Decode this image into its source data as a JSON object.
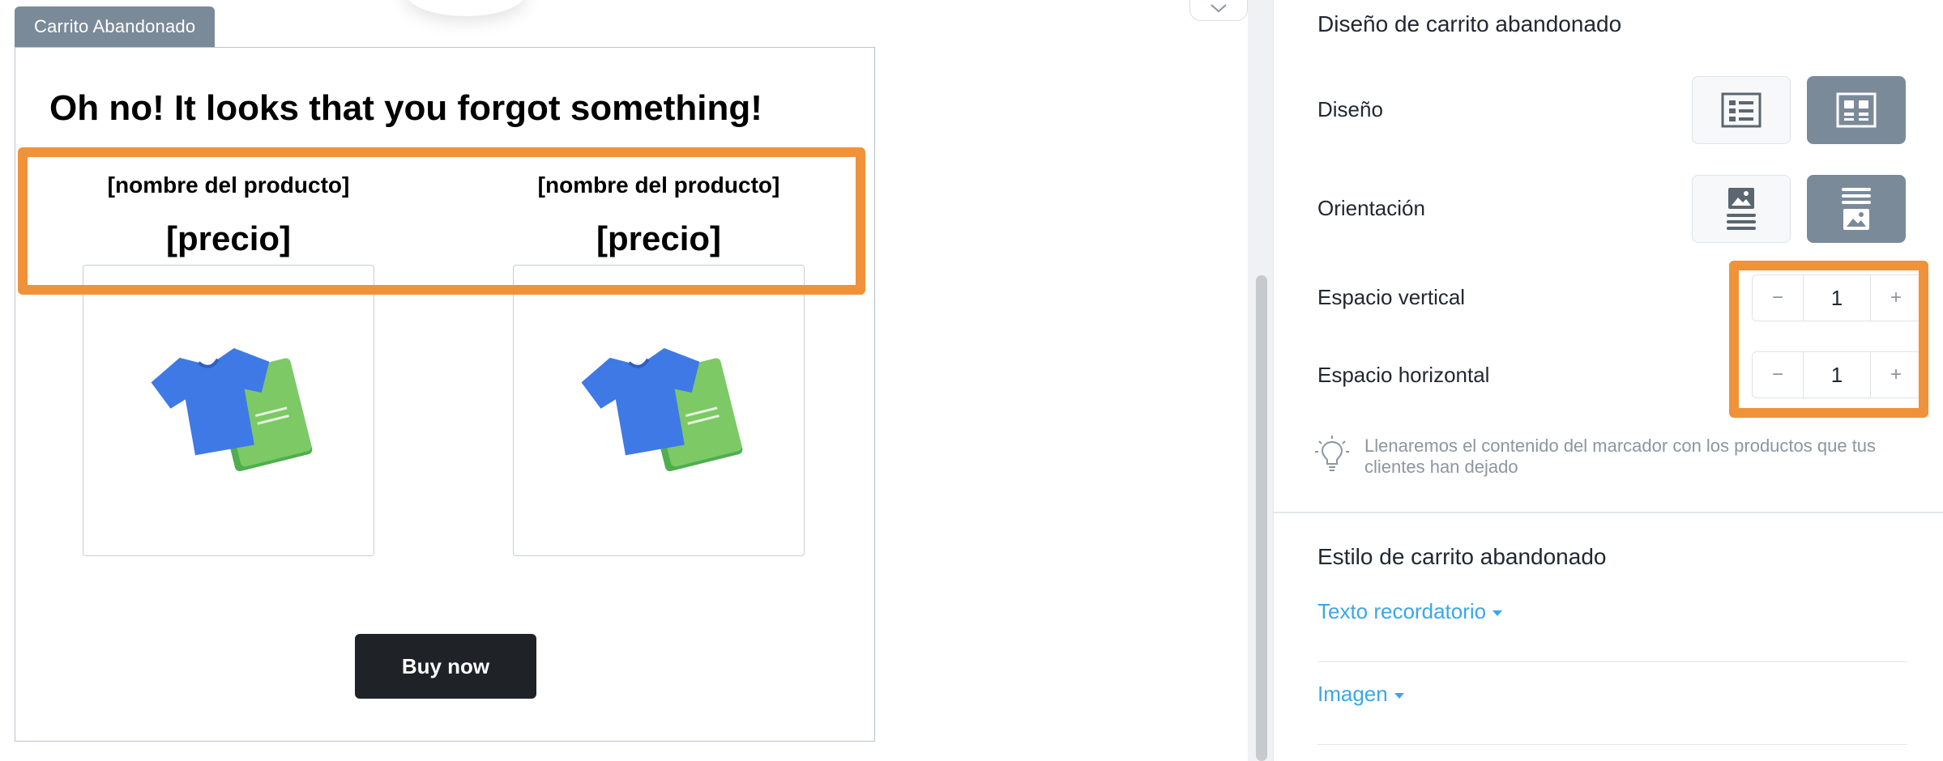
{
  "editor": {
    "block_tab": "Carrito Abandonado",
    "heading": "Oh no! It looks that you forgot something!",
    "products": [
      {
        "name": "[nombre del producto]",
        "price": "[precio]",
        "image_icon": "tshirt-book-illustration"
      },
      {
        "name": "[nombre del producto]",
        "price": "[precio]",
        "image_icon": "tshirt-book-illustration"
      }
    ],
    "buy_button": "Buy now",
    "highlight_color": "#f0923a"
  },
  "panel": {
    "section_title": "Diseño de carrito abandonado",
    "design_label": "Diseño",
    "design_options": [
      {
        "icon": "list-layout-icon",
        "active": false
      },
      {
        "icon": "grid-layout-icon",
        "active": true
      }
    ],
    "orientation_label": "Orientación",
    "orientation_options": [
      {
        "icon": "image-above-text-icon",
        "active": false
      },
      {
        "icon": "image-below-text-icon",
        "active": true
      }
    ],
    "vertical_space": {
      "label": "Espacio vertical",
      "value": "1",
      "minus": "−",
      "plus": "+"
    },
    "horizontal_space": {
      "label": "Espacio horizontal",
      "value": "1",
      "minus": "−",
      "plus": "+"
    },
    "hint": "Llenaremos el contenido del marcador con los productos que tus clientes han dejado",
    "style_section_title": "Estilo de carrito abandonado",
    "accordions": [
      "Texto recordatorio",
      "Imagen"
    ],
    "accent_color": "#3aa7e6",
    "active_button_color": "#7b8a99"
  }
}
